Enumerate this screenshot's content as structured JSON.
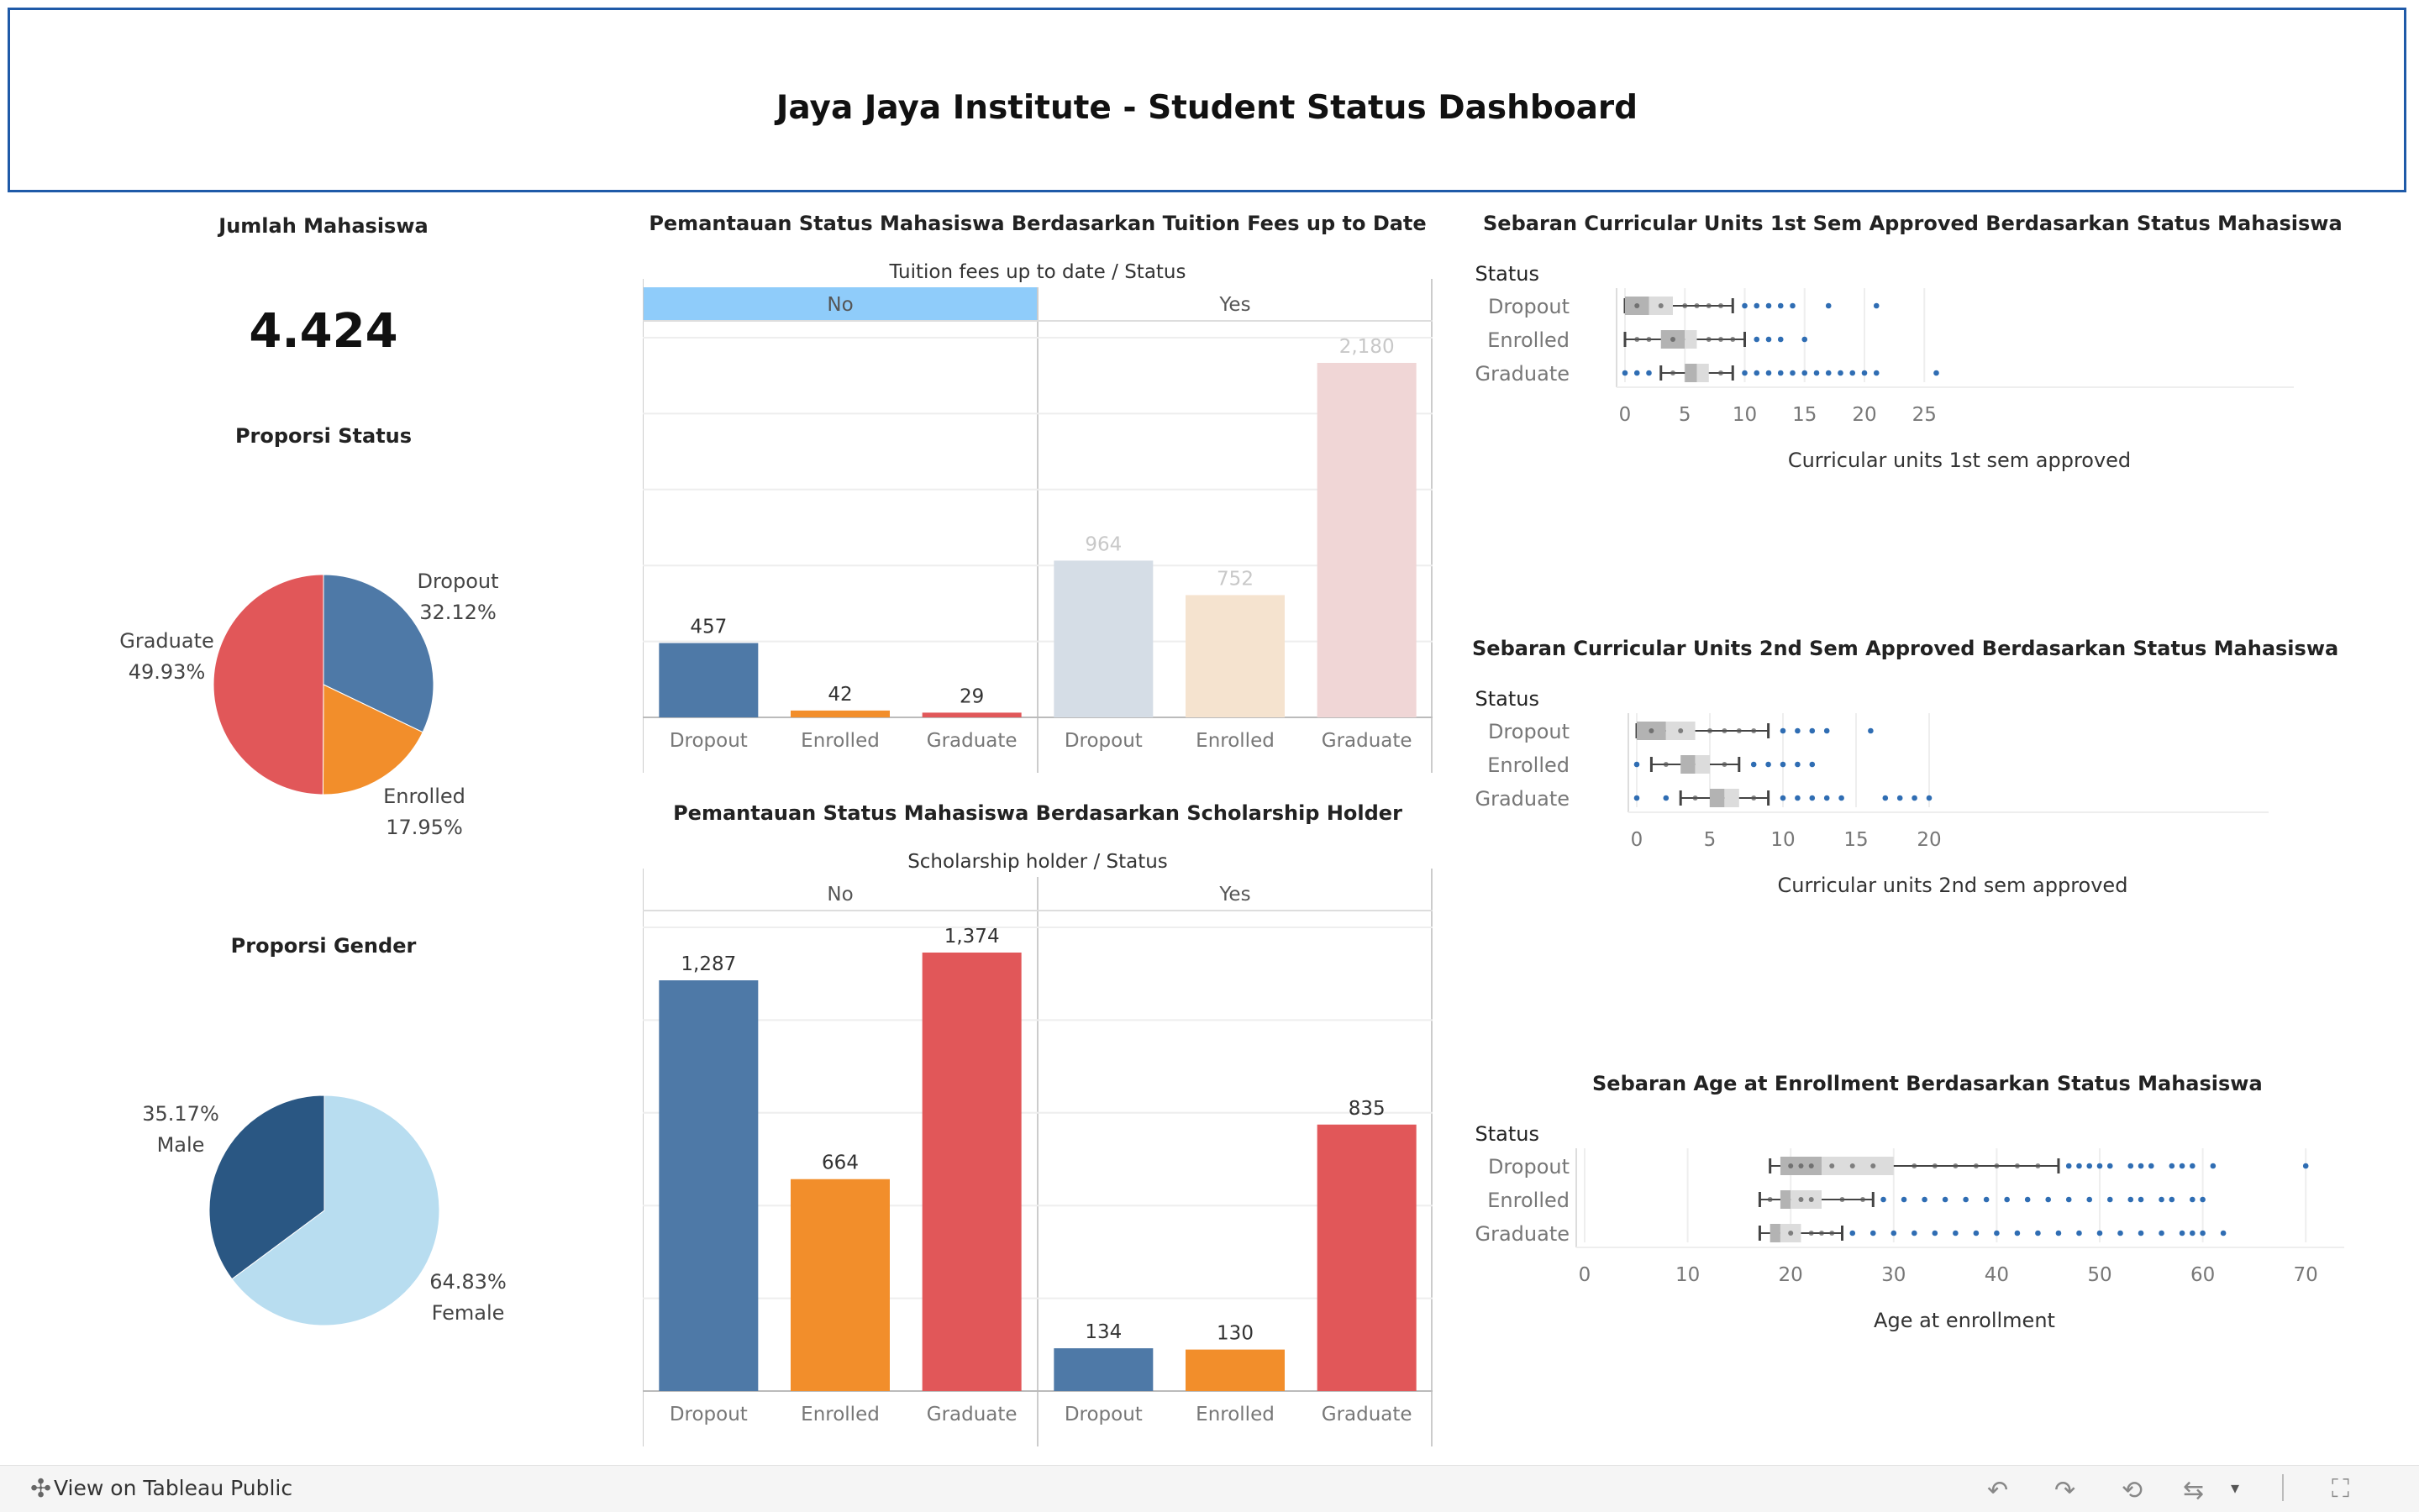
{
  "title": "Jaya Jaya Institute - Student Status Dashboard",
  "kpi": {
    "title": "Jumlah Mahasiswa",
    "value": "4.424"
  },
  "status_pie": {
    "title": "Proporsi Status",
    "slices": [
      {
        "name": "Dropout",
        "pct": "32.12%",
        "value": 32.12,
        "color": "#4e79a7"
      },
      {
        "name": "Enrolled",
        "pct": "17.95%",
        "value": 17.95,
        "color": "#f28e2b"
      },
      {
        "name": "Graduate",
        "pct": "49.93%",
        "value": 49.93,
        "color": "#e15759"
      }
    ]
  },
  "gender_pie": {
    "title": "Proporsi Gender",
    "slices": [
      {
        "name": "Female",
        "pct": "64.83%",
        "value": 64.83,
        "color": "#b8ddf0"
      },
      {
        "name": "Male",
        "pct": "35.17%",
        "value": 35.17,
        "color": "#2a5783"
      }
    ]
  },
  "chart_data": [
    {
      "type": "bar",
      "title": "Pemantauan Status Mahasiswa Berdasarkan Tuition Fees up to Date",
      "subtitle": "Tuition fees up to date / Status",
      "groups": [
        "No",
        "Yes"
      ],
      "selected_group": "No",
      "categories": [
        "Dropout",
        "Enrolled",
        "Graduate"
      ],
      "series": [
        {
          "group": "No",
          "values": [
            457,
            42,
            29
          ],
          "labels": [
            "457",
            "42",
            "29"
          ]
        },
        {
          "group": "Yes",
          "values": [
            964,
            752,
            2180
          ],
          "labels": [
            "964",
            "752",
            "2,180"
          ]
        }
      ],
      "ylim": [
        0,
        2180
      ],
      "colors": [
        "#4e79a7",
        "#f28e2b",
        "#e15759"
      ],
      "faded_colors": [
        "#d5dde6",
        "#f5e3cf",
        "#f0d6d6"
      ]
    },
    {
      "type": "bar",
      "title": "Pemantauan Status Mahasiswa Berdasarkan Scholarship Holder",
      "subtitle": "Scholarship holder / Status",
      "groups": [
        "No",
        "Yes"
      ],
      "categories": [
        "Dropout",
        "Enrolled",
        "Graduate"
      ],
      "series": [
        {
          "group": "No",
          "values": [
            1287,
            664,
            1374
          ],
          "labels": [
            "1,287",
            "664",
            "1,374"
          ]
        },
        {
          "group": "Yes",
          "values": [
            134,
            130,
            835
          ],
          "labels": [
            "134",
            "130",
            "835"
          ]
        }
      ],
      "ylim": [
        0,
        1374
      ],
      "colors": [
        "#4e79a7",
        "#f28e2b",
        "#e15759"
      ]
    },
    {
      "type": "box",
      "title": "Sebaran Curricular Units 1st Sem Approved Berdasarkan Status Mahasiswa",
      "legend_title": "Status",
      "xlabel": "Curricular units 1st sem approved",
      "ticks": [
        0,
        5,
        10,
        15,
        20,
        25
      ],
      "xlim": [
        0,
        27
      ],
      "rows": [
        {
          "name": "Dropout",
          "min": 0,
          "q1": 0,
          "median": 2,
          "q3": 4,
          "max": 9,
          "outliers": [
            10,
            11,
            12,
            13,
            14,
            17,
            21
          ],
          "points": [
            1,
            3,
            5,
            6,
            7,
            8
          ]
        },
        {
          "name": "Enrolled",
          "min": 0,
          "q1": 3,
          "median": 5,
          "q3": 6,
          "max": 10,
          "outliers": [
            11,
            12,
            13,
            15
          ],
          "points": [
            1,
            2,
            4,
            7,
            8,
            9
          ]
        },
        {
          "name": "Graduate",
          "min": 3,
          "q1": 5,
          "median": 6,
          "q3": 7,
          "max": 9,
          "outliers": [
            0,
            1,
            2,
            10,
            11,
            12,
            13,
            14,
            15,
            16,
            17,
            18,
            19,
            20,
            21,
            26
          ],
          "points": [
            4,
            8
          ]
        }
      ]
    },
    {
      "type": "box",
      "title": "Sebaran Curricular Units 2nd Sem Approved Berdasarkan Status Mahasiswa",
      "legend_title": "Status",
      "xlabel": "Curricular units 2nd sem approved",
      "ticks": [
        0,
        5,
        10,
        15,
        20
      ],
      "xlim": [
        0,
        21
      ],
      "rows": [
        {
          "name": "Dropout",
          "min": 0,
          "q1": 0,
          "median": 2,
          "q3": 4,
          "max": 9,
          "outliers": [
            10,
            11,
            12,
            13,
            16
          ],
          "points": [
            1,
            3,
            5,
            6,
            7,
            8
          ]
        },
        {
          "name": "Enrolled",
          "min": 1,
          "q1": 3,
          "median": 4,
          "q3": 5,
          "max": 7,
          "outliers": [
            0,
            8,
            9,
            10,
            11,
            12
          ],
          "points": [
            2,
            6
          ]
        },
        {
          "name": "Graduate",
          "min": 3,
          "q1": 5,
          "median": 6,
          "q3": 7,
          "max": 9,
          "outliers": [
            0,
            2,
            10,
            11,
            12,
            13,
            14,
            17,
            18,
            19,
            20
          ],
          "points": [
            4,
            8
          ]
        }
      ]
    },
    {
      "type": "box",
      "title": "Sebaran Age at Enrollment Berdasarkan Status Mahasiswa",
      "legend_title": "Status",
      "xlabel": "Age at enrollment",
      "ticks": [
        0,
        10,
        20,
        30,
        40,
        50,
        60,
        70
      ],
      "xlim": [
        0,
        74
      ],
      "rows": [
        {
          "name": "Dropout",
          "min": 18,
          "q1": 19,
          "median": 23,
          "q3": 30,
          "max": 46,
          "outliers": [
            47,
            48,
            49,
            50,
            51,
            53,
            54,
            55,
            57,
            58,
            59,
            61,
            70
          ],
          "points": [
            20,
            21,
            22,
            24,
            26,
            28,
            32,
            34,
            36,
            38,
            40,
            42,
            44
          ]
        },
        {
          "name": "Enrolled",
          "min": 17,
          "q1": 19,
          "median": 20,
          "q3": 23,
          "max": 28,
          "outliers": [
            29,
            31,
            33,
            35,
            37,
            39,
            41,
            43,
            45,
            47,
            49,
            51,
            53,
            54,
            56,
            57,
            59,
            60
          ],
          "points": [
            18,
            21,
            22,
            25,
            27
          ]
        },
        {
          "name": "Graduate",
          "min": 17,
          "q1": 18,
          "median": 19,
          "q3": 21,
          "max": 25,
          "outliers": [
            26,
            28,
            30,
            32,
            34,
            36,
            38,
            40,
            42,
            44,
            46,
            48,
            50,
            52,
            54,
            56,
            58,
            59,
            60,
            62
          ],
          "points": [
            20,
            22,
            23,
            24
          ]
        }
      ]
    }
  ],
  "footer": {
    "view_label": "View on Tableau Public"
  }
}
